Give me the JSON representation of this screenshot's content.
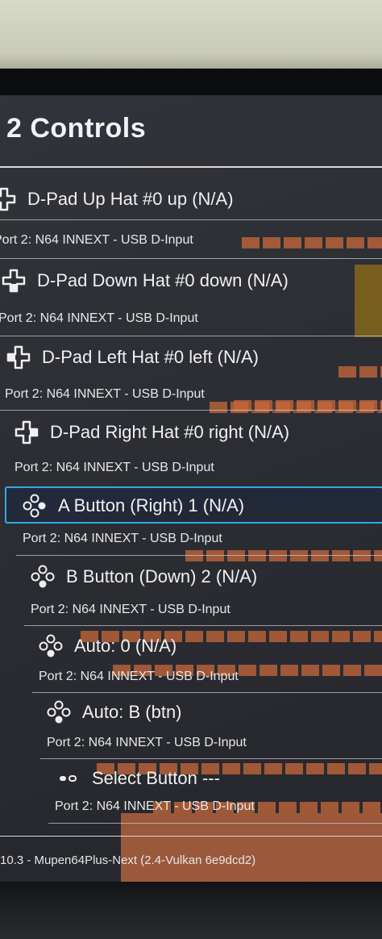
{
  "menu": {
    "title": "2 Controls",
    "items": [
      {
        "label": "D-Pad Up Hat #0 up (N/A)",
        "sub": "Port 2: N64 INNEXT - USB D-Input",
        "icon": "dpad-icon"
      },
      {
        "label": "D-Pad Down Hat #0 down (N/A)",
        "sub": "Port 2: N64 INNEXT - USB D-Input",
        "icon": "dpad-icon"
      },
      {
        "label": "D-Pad Left Hat #0 left (N/A)",
        "sub": "Port 2: N64 INNEXT - USB D-Input",
        "icon": "dpad-icon"
      },
      {
        "label": "D-Pad Right Hat #0 right (N/A)",
        "sub": "Port 2: N64 INNEXT - USB D-Input",
        "icon": "dpad-icon"
      },
      {
        "label": "A Button (Right) 1 (N/A)",
        "sub": "Port 2: N64 INNEXT - USB D-Input",
        "icon": "face-buttons-icon"
      },
      {
        "label": "B Button (Down) 2 (N/A)",
        "sub": "Port 2: N64 INNEXT - USB D-Input",
        "icon": "face-buttons-icon"
      },
      {
        "label": "Auto: 0 (N/A)",
        "sub": "Port 2: N64 INNEXT - USB D-Input",
        "icon": "face-buttons-icon"
      },
      {
        "label": "Auto:  B (btn)",
        "sub": "Port 2: N64 INNEXT - USB D-Input",
        "icon": "face-buttons-icon"
      },
      {
        "label": "Select Button ---",
        "sub": "Port 2: N64 INNEXT - USB D-Input",
        "icon": "select-icon"
      }
    ],
    "selected_index": 4
  },
  "footer": {
    "text": "10.3 - Mupen64Plus-Next (2.4-Vulkan 6e9dcd2)"
  },
  "colors": {
    "highlight": "#33a9e8",
    "text": "#f0f0f0",
    "background": "#2b2d34"
  }
}
